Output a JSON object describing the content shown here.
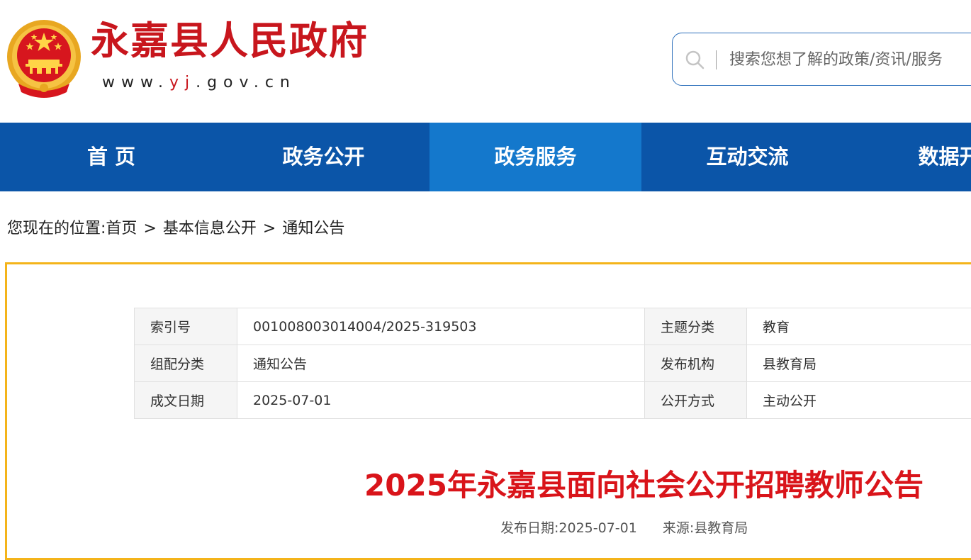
{
  "header": {
    "site_title": "永嘉县人民政府",
    "url_prefix": "www.",
    "url_highlight": "yj",
    "url_suffix": ".gov.cn",
    "emblem_icon": "national-emblem-icon",
    "colors": {
      "title_red": "#c8161d",
      "nav_blue": "#0b55a8",
      "nav_active": "#1478cc",
      "panel_border": "#f4b41a"
    }
  },
  "search": {
    "icon": "search-icon",
    "placeholder": "搜索您想了解的政策/资讯/服务"
  },
  "nav": {
    "items": [
      {
        "label": "首  页"
      },
      {
        "label": "政务公开"
      },
      {
        "label": "政务服务",
        "active": true
      },
      {
        "label": "互动交流"
      },
      {
        "label": "数据开放"
      }
    ]
  },
  "breadcrumb": {
    "prefix": "您现在的位置:",
    "items": [
      "首页",
      "基本信息公开",
      "通知公告"
    ],
    "separator": ">"
  },
  "info_table": {
    "rows": [
      {
        "label1": "索引号",
        "value1": "001008003014004/2025-319503",
        "label2": "主题分类",
        "value2": "教育"
      },
      {
        "label1": "组配分类",
        "value1": "通知公告",
        "label2": "发布机构",
        "value2": "县教育局"
      },
      {
        "label1": "成文日期",
        "value1": "2025-07-01",
        "label2": "公开方式",
        "value2": "主动公开"
      }
    ]
  },
  "article": {
    "title": "2025年永嘉县面向社会公开招聘教师公告",
    "publish_date_label": "发布日期:",
    "publish_date": "2025-07-01",
    "source_label": "来源:",
    "source": "县教育局"
  }
}
